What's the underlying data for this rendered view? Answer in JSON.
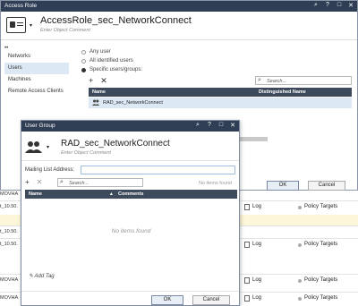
{
  "background_table": {
    "rows": [
      {
        "prefix": "MOVHA",
        "track": "",
        "install": ""
      },
      {
        "prefix": "t_10.50.",
        "track": "Log",
        "install": "Policy Targets"
      },
      {
        "prefix": "t_10.50.",
        "track": "",
        "install": ""
      },
      {
        "prefix": "t_10.50.",
        "track": "Log",
        "install": "Policy Targets"
      },
      {
        "prefix": "MOVHA",
        "track": "Log",
        "install": "Policy Targets"
      },
      {
        "prefix": "MOVHA",
        "track": "Log",
        "install": "Policy Targets"
      }
    ]
  },
  "access_role": {
    "window_title": "Access Role",
    "title": "AccessRole_sec_NetworkConnect",
    "comment_placeholder": "Enter Object Comment",
    "nav_dots": "••",
    "nav": [
      "Networks",
      "Users",
      "Machines",
      "Remote Access Clients"
    ],
    "options": [
      "Any user",
      "All identified users",
      "Specific users/groups:"
    ],
    "toolbar": {
      "add": "+",
      "remove": "✕"
    },
    "search_placeholder": "Search...",
    "columns": [
      "Name",
      "Distinguished Name"
    ],
    "rows": [
      {
        "name": "RAD_sec_NetworkConnect"
      }
    ],
    "ok_label": "OK",
    "cancel_label": "Cancel"
  },
  "user_group": {
    "window_title": "User Group",
    "title": "RAD_sec_NetworkConnect",
    "comment_placeholder": "Enter Object Comment",
    "mailing_label": "Mailing List Address:",
    "toolbar": {
      "add": "+",
      "remove": "✕"
    },
    "search_placeholder": "Search...",
    "no_items_found": "No items found",
    "columns": [
      "Name",
      "Comments"
    ],
    "empty_text": "No items found",
    "add_tag": "Add Tag",
    "ok_label": "OK",
    "cancel_label": "Cancel"
  },
  "titlebar_icons": [
    "search-icon",
    "help-icon",
    "maximize-icon",
    "close-icon"
  ]
}
